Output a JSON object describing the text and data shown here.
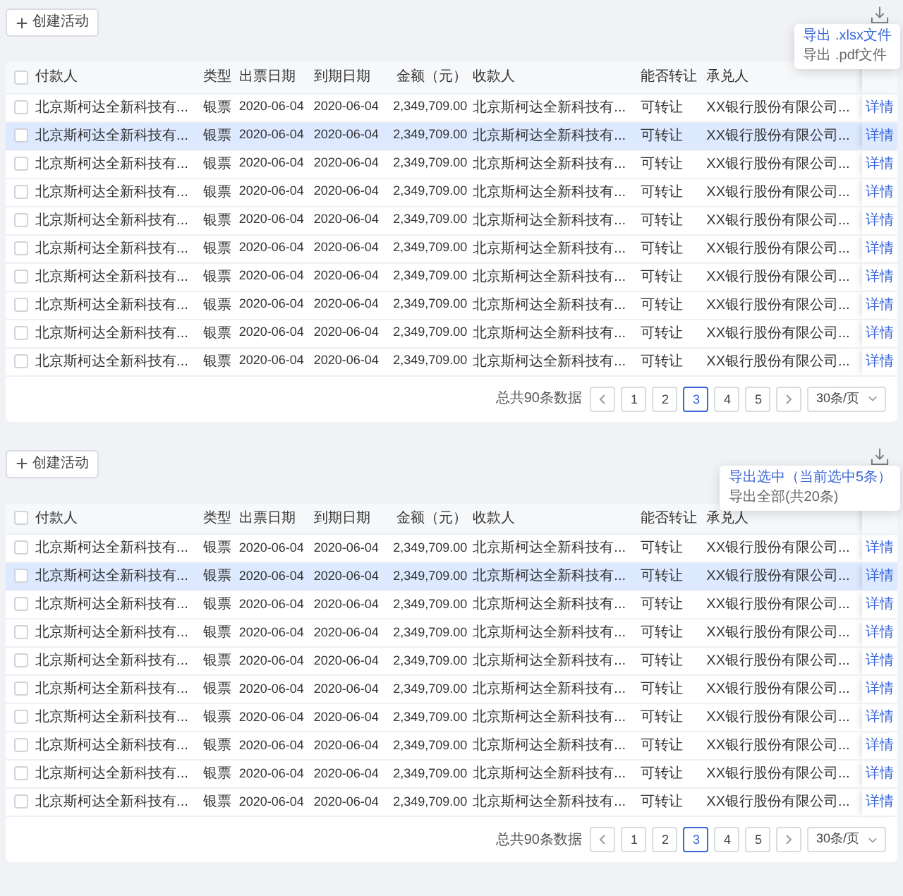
{
  "panels": [
    {
      "create_button": "创建活动",
      "export_menu": {
        "items": [
          {
            "label": "导出 .xlsx文件",
            "selected": true
          },
          {
            "label": "导出 .pdf文件",
            "selected": false
          }
        ]
      },
      "table": {
        "header_checked": false,
        "columns": [
          "付款人",
          "类型",
          "出票日期",
          "到期日期",
          "金额（元）",
          "收款人",
          "能否转让",
          "承兑人"
        ],
        "rows": [
          {
            "checked": false,
            "hovered": false,
            "cells": [
              "北京斯柯达全新科技有...",
              "银票",
              "2020-06-04",
              "2020-06-04",
              "2,349,709.00",
              "北京斯柯达全新科技有...",
              "可转让",
              "XX银行股份有限公司..."
            ],
            "action": "详情"
          },
          {
            "checked": false,
            "hovered": true,
            "cells": [
              "北京斯柯达全新科技有...",
              "银票",
              "2020-06-04",
              "2020-06-04",
              "2,349,709.00",
              "北京斯柯达全新科技有...",
              "可转让",
              "XX银行股份有限公司..."
            ],
            "action": "详情"
          },
          {
            "checked": false,
            "hovered": false,
            "cells": [
              "北京斯柯达全新科技有...",
              "银票",
              "2020-06-04",
              "2020-06-04",
              "2,349,709.00",
              "北京斯柯达全新科技有...",
              "可转让",
              "XX银行股份有限公司..."
            ],
            "action": "详情"
          },
          {
            "checked": false,
            "hovered": false,
            "cells": [
              "北京斯柯达全新科技有...",
              "银票",
              "2020-06-04",
              "2020-06-04",
              "2,349,709.00",
              "北京斯柯达全新科技有...",
              "可转让",
              "XX银行股份有限公司..."
            ],
            "action": "详情"
          },
          {
            "checked": false,
            "hovered": false,
            "cells": [
              "北京斯柯达全新科技有...",
              "银票",
              "2020-06-04",
              "2020-06-04",
              "2,349,709.00",
              "北京斯柯达全新科技有...",
              "可转让",
              "XX银行股份有限公司..."
            ],
            "action": "详情"
          },
          {
            "checked": false,
            "hovered": false,
            "cells": [
              "北京斯柯达全新科技有...",
              "银票",
              "2020-06-04",
              "2020-06-04",
              "2,349,709.00",
              "北京斯柯达全新科技有...",
              "可转让",
              "XX银行股份有限公司..."
            ],
            "action": "详情"
          },
          {
            "checked": false,
            "hovered": false,
            "cells": [
              "北京斯柯达全新科技有...",
              "银票",
              "2020-06-04",
              "2020-06-04",
              "2,349,709.00",
              "北京斯柯达全新科技有...",
              "可转让",
              "XX银行股份有限公司..."
            ],
            "action": "详情"
          },
          {
            "checked": false,
            "hovered": false,
            "cells": [
              "北京斯柯达全新科技有...",
              "银票",
              "2020-06-04",
              "2020-06-04",
              "2,349,709.00",
              "北京斯柯达全新科技有...",
              "可转让",
              "XX银行股份有限公司..."
            ],
            "action": "详情"
          },
          {
            "checked": false,
            "hovered": false,
            "cells": [
              "北京斯柯达全新科技有...",
              "银票",
              "2020-06-04",
              "2020-06-04",
              "2,349,709.00",
              "北京斯柯达全新科技有...",
              "可转让",
              "XX银行股份有限公司..."
            ],
            "action": "详情"
          },
          {
            "checked": false,
            "hovered": false,
            "cells": [
              "北京斯柯达全新科技有...",
              "银票",
              "2020-06-04",
              "2020-06-04",
              "2,349,709.00",
              "北京斯柯达全新科技有...",
              "可转让",
              "XX银行股份有限公司..."
            ],
            "action": "详情"
          }
        ]
      },
      "pagination": {
        "total": "总共90条数据",
        "pages": [
          {
            "label": "1",
            "selected": false
          },
          {
            "label": "2",
            "selected": false
          },
          {
            "label": "3",
            "selected": true
          },
          {
            "label": "4",
            "selected": false
          },
          {
            "label": "5",
            "selected": false
          }
        ],
        "page_size": "30条/页"
      }
    },
    {
      "create_button": "创建活动",
      "export_menu": {
        "items": [
          {
            "label": "导出选中（当前选中5条）",
            "selected": true
          },
          {
            "label": "导出全部(共20条)",
            "selected": false
          }
        ]
      },
      "table": {
        "header_checked": false,
        "columns": [
          "付款人",
          "类型",
          "出票日期",
          "到期日期",
          "金额（元）",
          "收款人",
          "能否转让",
          "承兑人"
        ],
        "rows": [
          {
            "checked": false,
            "hovered": false,
            "cells": [
              "北京斯柯达全新科技有...",
              "银票",
              "2020-06-04",
              "2020-06-04",
              "2,349,709.00",
              "北京斯柯达全新科技有...",
              "可转让",
              "XX银行股份有限公司..."
            ],
            "action": "详情"
          },
          {
            "checked": false,
            "hovered": true,
            "cells": [
              "北京斯柯达全新科技有...",
              "银票",
              "2020-06-04",
              "2020-06-04",
              "2,349,709.00",
              "北京斯柯达全新科技有...",
              "可转让",
              "XX银行股份有限公司..."
            ],
            "action": "详情"
          },
          {
            "checked": false,
            "hovered": false,
            "cells": [
              "北京斯柯达全新科技有...",
              "银票",
              "2020-06-04",
              "2020-06-04",
              "2,349,709.00",
              "北京斯柯达全新科技有...",
              "可转让",
              "XX银行股份有限公司..."
            ],
            "action": "详情"
          },
          {
            "checked": false,
            "hovered": false,
            "cells": [
              "北京斯柯达全新科技有...",
              "银票",
              "2020-06-04",
              "2020-06-04",
              "2,349,709.00",
              "北京斯柯达全新科技有...",
              "可转让",
              "XX银行股份有限公司..."
            ],
            "action": "详情"
          },
          {
            "checked": false,
            "hovered": false,
            "cells": [
              "北京斯柯达全新科技有...",
              "银票",
              "2020-06-04",
              "2020-06-04",
              "2,349,709.00",
              "北京斯柯达全新科技有...",
              "可转让",
              "XX银行股份有限公司..."
            ],
            "action": "详情"
          },
          {
            "checked": false,
            "hovered": false,
            "cells": [
              "北京斯柯达全新科技有...",
              "银票",
              "2020-06-04",
              "2020-06-04",
              "2,349,709.00",
              "北京斯柯达全新科技有...",
              "可转让",
              "XX银行股份有限公司..."
            ],
            "action": "详情"
          },
          {
            "checked": false,
            "hovered": false,
            "cells": [
              "北京斯柯达全新科技有...",
              "银票",
              "2020-06-04",
              "2020-06-04",
              "2,349,709.00",
              "北京斯柯达全新科技有...",
              "可转让",
              "XX银行股份有限公司..."
            ],
            "action": "详情"
          },
          {
            "checked": false,
            "hovered": false,
            "cells": [
              "北京斯柯达全新科技有...",
              "银票",
              "2020-06-04",
              "2020-06-04",
              "2,349,709.00",
              "北京斯柯达全新科技有...",
              "可转让",
              "XX银行股份有限公司..."
            ],
            "action": "详情"
          },
          {
            "checked": false,
            "hovered": false,
            "cells": [
              "北京斯柯达全新科技有...",
              "银票",
              "2020-06-04",
              "2020-06-04",
              "2,349,709.00",
              "北京斯柯达全新科技有...",
              "可转让",
              "XX银行股份有限公司..."
            ],
            "action": "详情"
          },
          {
            "checked": false,
            "hovered": false,
            "cells": [
              "北京斯柯达全新科技有...",
              "银票",
              "2020-06-04",
              "2020-06-04",
              "2,349,709.00",
              "北京斯柯达全新科技有...",
              "可转让",
              "XX银行股份有限公司..."
            ],
            "action": "详情"
          }
        ]
      },
      "pagination": {
        "total": "总共90条数据",
        "pages": [
          {
            "label": "1",
            "selected": false
          },
          {
            "label": "2",
            "selected": false
          },
          {
            "label": "3",
            "selected": true
          },
          {
            "label": "4",
            "selected": false
          },
          {
            "label": "5",
            "selected": false
          }
        ],
        "page_size": "30条/页"
      }
    }
  ]
}
